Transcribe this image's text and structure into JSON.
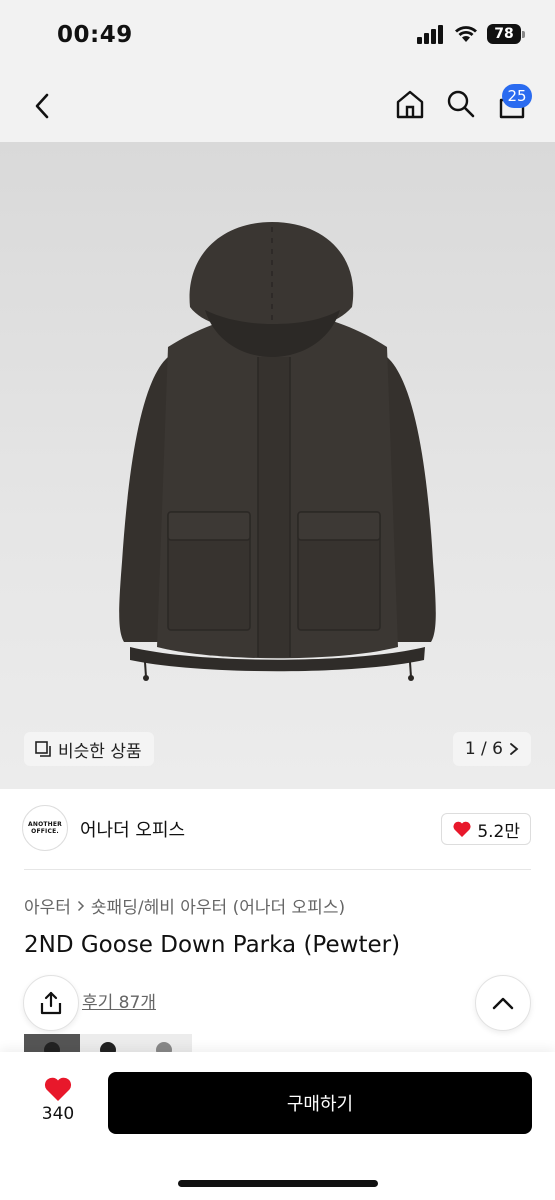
{
  "status_bar": {
    "time": "00:49",
    "battery": "78",
    "icons": [
      "signal-icon",
      "wifi-icon",
      "battery-icon"
    ]
  },
  "nav": {
    "back_icon": "chevron-left-icon",
    "home_icon": "home-icon",
    "search_icon": "search-icon",
    "cart_icon": "cart-icon",
    "cart_count": "25"
  },
  "product_image": {
    "similar_label": "비슷한 상품",
    "page_indicator": "1 / 6",
    "colors": {
      "jacket": "#3a3632",
      "background": "#e2e2e2"
    }
  },
  "brand": {
    "logo_text": "ANOTHER OFFICE.",
    "name": "어나더 오피스",
    "likes": "5.2만"
  },
  "product": {
    "breadcrumb": [
      "아우터",
      "숏패딩/헤비 아우터 (어나더 오피스)"
    ],
    "title": "2ND Goose Down Parka (Pewter)",
    "review_link": "후기 87개"
  },
  "bottom": {
    "wish_count": "340",
    "buy_label": "구매하기"
  },
  "accent_colors": {
    "badge": "#2a6bf0",
    "heart": "#e8182b",
    "buy_button": "#000000"
  }
}
